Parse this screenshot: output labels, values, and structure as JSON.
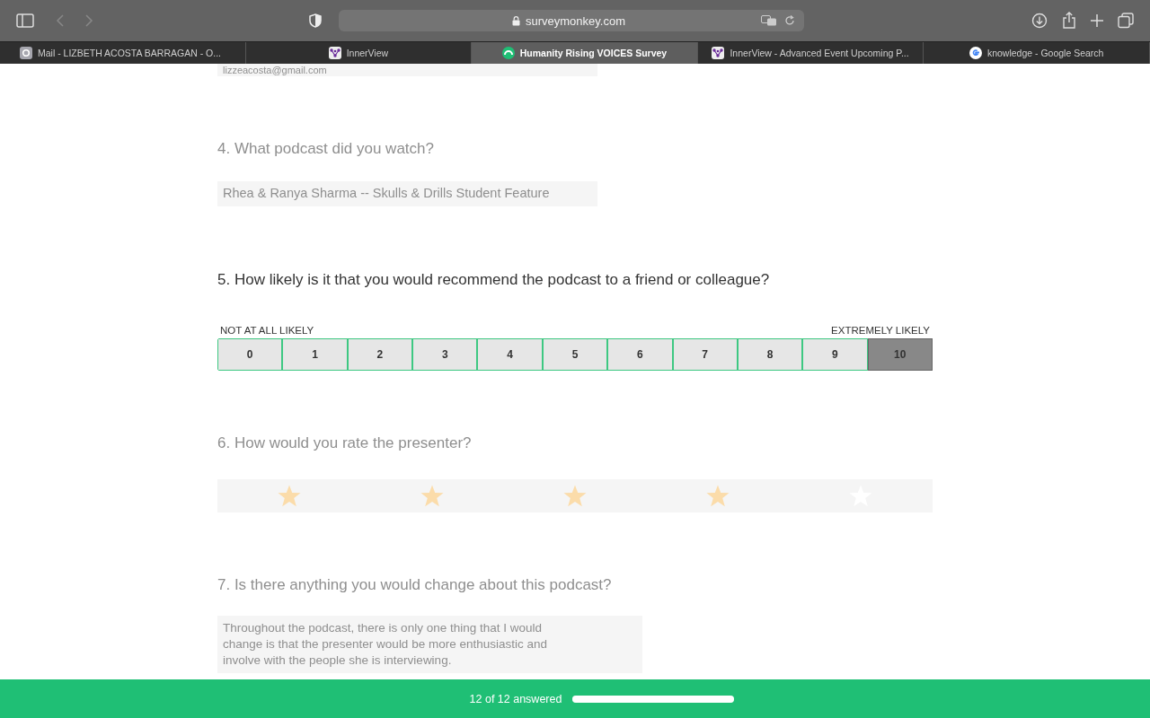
{
  "browser": {
    "address": "surveymonkey.com",
    "tabs": [
      {
        "label": "Mail - LIZBETH ACOSTA BARRAGAN - O...",
        "selected": false
      },
      {
        "label": "InnerView",
        "selected": false
      },
      {
        "label": "Humanity Rising VOICES Survey",
        "selected": true
      },
      {
        "label": "InnerView - Advanced Event Upcoming P...",
        "selected": false
      },
      {
        "label": "knowledge - Google Search",
        "selected": false
      }
    ]
  },
  "previous_answer": {
    "value": "lizzeacosta@gmail.com"
  },
  "questions": [
    {
      "kind": "text",
      "title": "4. What podcast did you watch?",
      "active": false,
      "value": "Rhea & Ranya Sharma -- Skulls & Drills Student Feature"
    },
    {
      "kind": "nps",
      "title": "5. How likely is it that you would recommend the podcast to a friend or colleague?",
      "active": true,
      "low_label": "NOT AT ALL LIKELY",
      "high_label": "EXTREMELY LIKELY",
      "options": [
        {
          "label": "0",
          "selected": false
        },
        {
          "label": "1",
          "selected": false
        },
        {
          "label": "2",
          "selected": false
        },
        {
          "label": "3",
          "selected": false
        },
        {
          "label": "4",
          "selected": false
        },
        {
          "label": "5",
          "selected": false
        },
        {
          "label": "6",
          "selected": false
        },
        {
          "label": "7",
          "selected": false
        },
        {
          "label": "8",
          "selected": false
        },
        {
          "label": "9",
          "selected": false
        },
        {
          "label": "10",
          "selected": true
        }
      ]
    },
    {
      "kind": "stars",
      "title": "6. How would you rate the presenter?",
      "active": false,
      "stars": 4
    },
    {
      "kind": "textarea",
      "title": "7. Is there anything you would change about this podcast?",
      "active": false,
      "value": "Throughout the podcast, there is only one thing that I would change is that the presenter would be more enthusiastic and involve with the people she is interviewing."
    }
  ],
  "progress": {
    "text": "12 of 12 answered",
    "level": 1
  }
}
